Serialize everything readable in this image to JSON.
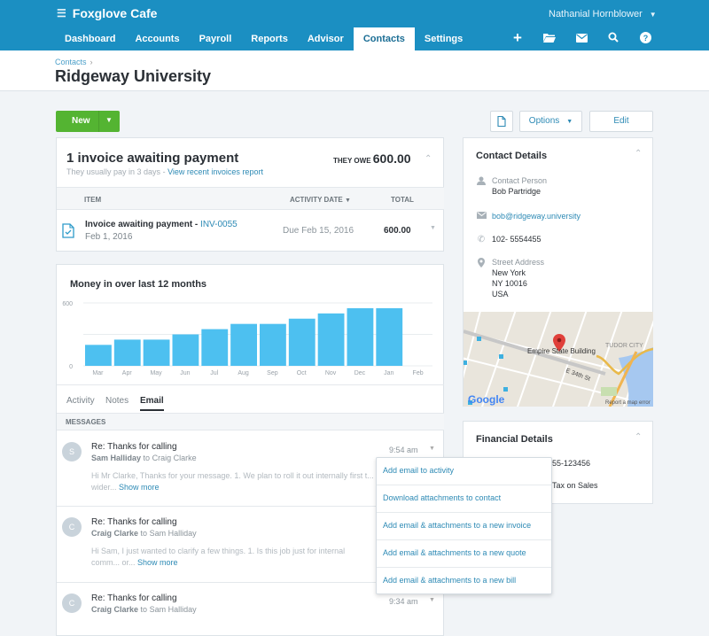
{
  "app": {
    "org_name": "Foxglove Cafe",
    "user_name": "Nathanial Hornblower",
    "nav": [
      "Dashboard",
      "Accounts",
      "Payroll",
      "Reports",
      "Advisor",
      "Contacts",
      "Settings"
    ],
    "active_nav": "Contacts",
    "toolbar_icons": [
      "plus-icon",
      "folder-icon",
      "mail-icon",
      "search-icon",
      "help-icon"
    ]
  },
  "page": {
    "breadcrumb": "Contacts",
    "title": "Ridgeway University"
  },
  "actions": {
    "new_label": "New",
    "options_label": "Options",
    "edit_label": "Edit"
  },
  "invoices": {
    "title": "1 invoice awaiting payment",
    "subtitle": "They usually pay in 3 days",
    "report_link": "View recent invoices report",
    "owe_label": "THEY OWE",
    "owe_amount": "600.00",
    "columns": [
      "ITEM",
      "ACTIVITY DATE",
      "TOTAL"
    ],
    "rows": [
      {
        "title": "Invoice awaiting payment",
        "number": "INV-0055",
        "date": "Feb 1, 2016",
        "due": "Due Feb 15, 2016",
        "total": "600.00"
      }
    ]
  },
  "chart_data": {
    "type": "bar",
    "title": "Money in over last 12 months",
    "categories": [
      "Mar",
      "Apr",
      "May",
      "Jun",
      "Jul",
      "Aug",
      "Sep",
      "Oct",
      "Nov",
      "Dec",
      "Jan",
      "Feb"
    ],
    "values": [
      200,
      250,
      250,
      300,
      350,
      400,
      400,
      450,
      500,
      550,
      550,
      0
    ],
    "ylim": [
      0,
      600
    ],
    "yticks": [
      "0",
      "600"
    ],
    "grid": true,
    "color": "#4dc0f0"
  },
  "activity_tabs": [
    "Activity",
    "Notes",
    "Email"
  ],
  "active_tab": "Email",
  "messages_header": "MESSAGES",
  "messages": [
    {
      "initial": "S",
      "subject": "Re: Thanks for calling",
      "from": "Sam Halliday",
      "to": "Craig Clarke",
      "body": "Hi Mr Clarke, Thanks for your message. 1. We plan to roll it out internally first t... wider...",
      "show_more": "Show more",
      "time": "9:54 am"
    },
    {
      "initial": "C",
      "subject": "Re: Thanks for calling",
      "from": "Craig Clarke",
      "to": "Sam Halliday",
      "body": "Hi Sam, I just wanted to clarify a few things. 1. Is this job just for internal comm... or...",
      "show_more": "Show more",
      "time": ""
    },
    {
      "initial": "C",
      "subject": "Re: Thanks for calling",
      "from": "Craig Clarke",
      "to": "Sam Halliday",
      "body": "",
      "show_more": "",
      "time": "9:34 am"
    }
  ],
  "dropdown_items": [
    "Add email to activity",
    "Download attachments to contact",
    "Add email & attachments to a new invoice",
    "Add email & attachments to a new quote",
    "Add email & attachments to a new bill"
  ],
  "contact": {
    "title": "Contact Details",
    "person_label": "Contact Person",
    "person": "Bob Partridge",
    "email": "bob@ridgeway.university",
    "phone": "102- 5554455",
    "address_label": "Street Address",
    "address": [
      "New York",
      "NY 10016",
      "USA"
    ],
    "map_labels": {
      "landmark": "Empire State Building",
      "area": "TUDOR CITY",
      "street": "E 34th St",
      "google": "Google",
      "report": "Report a map error"
    }
  },
  "financial": {
    "title": "Financial Details",
    "tax_number": "55-123456",
    "tax_type": "Tax on Sales"
  },
  "word_to": "to"
}
